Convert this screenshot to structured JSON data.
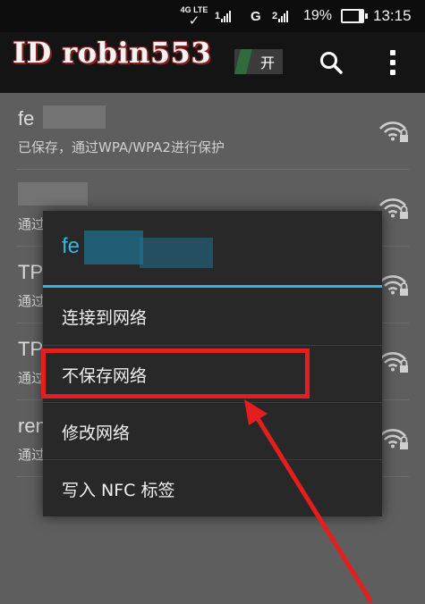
{
  "status_bar": {
    "network_type": "4G LTE",
    "sim1_number": "1",
    "carrier_g": "G",
    "sim2_number": "2",
    "battery_percent": "19%",
    "battery_level": 0.19,
    "time": "13:15"
  },
  "action_bar": {
    "watermark": "ID robin553",
    "wifi_toggle_label": "开",
    "search_icon": "search-icon",
    "more_icon": "overflow-menu-icon"
  },
  "wifi_list": [
    {
      "name": "fe",
      "subtitle": "已保存，通过WPA/WPA2进行保护"
    },
    {
      "name": "",
      "subtitle": "通过"
    },
    {
      "name": "TP",
      "subtitle": "通过"
    },
    {
      "name": "TP",
      "subtitle": "通过"
    },
    {
      "name": "ren",
      "subtitle": "通过"
    }
  ],
  "dialog": {
    "title": "fe",
    "items": [
      {
        "label": "连接到网络"
      },
      {
        "label": "不保存网络"
      },
      {
        "label": "修改网络"
      },
      {
        "label": "写入 NFC 标签"
      }
    ]
  },
  "colors": {
    "accent": "#33b5e5",
    "annotation_red": "#e41e1e",
    "dialog_bg": "#282828",
    "dimmed_bg": "#5e5e5e"
  }
}
